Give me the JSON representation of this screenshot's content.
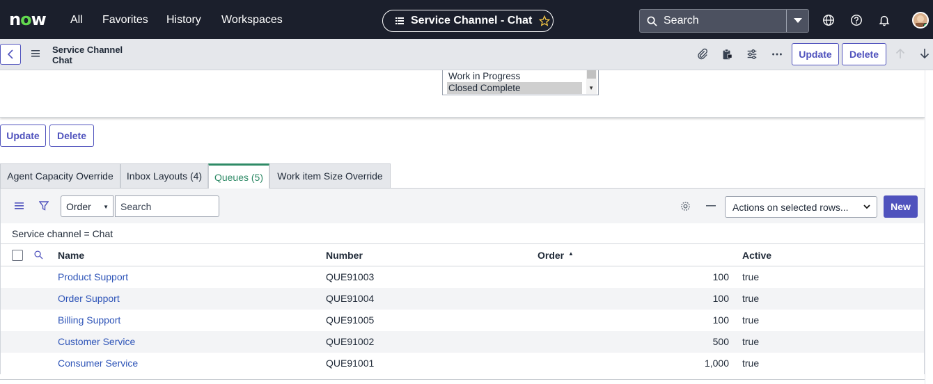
{
  "topnav": {
    "logo": "now",
    "links": [
      "All",
      "Favorites",
      "History",
      "Workspaces"
    ],
    "context_pill": "Service Channel - Chat",
    "search_label": "Search"
  },
  "formheader": {
    "title_line1": "Service Channel",
    "title_line2": "Chat",
    "update_label": "Update",
    "delete_label": "Delete"
  },
  "status_listbox": {
    "options": [
      "Work in Progress",
      "Closed Complete"
    ],
    "selected": "Closed Complete"
  },
  "form_buttons": {
    "update_label": "Update",
    "delete_label": "Delete"
  },
  "tabs": [
    {
      "label": "Agent Capacity Override",
      "active": false
    },
    {
      "label": "Inbox Layouts (4)",
      "active": false
    },
    {
      "label": "Queues (5)",
      "active": true
    },
    {
      "label": "Work item Size Override",
      "active": false
    }
  ],
  "listbar": {
    "search_field": "Order",
    "search_placeholder": "Search",
    "actions": "Actions on selected rows...",
    "new_label": "New"
  },
  "breadcrumb": "Service channel = Chat",
  "table": {
    "columns": [
      "Name",
      "Number",
      "Order",
      "Active"
    ],
    "rows": [
      {
        "name": "Product Support",
        "number": "QUE91003",
        "order": "100",
        "active": "true"
      },
      {
        "name": "Order Support",
        "number": "QUE91004",
        "order": "100",
        "active": "true"
      },
      {
        "name": "Billing Support",
        "number": "QUE91005",
        "order": "100",
        "active": "true"
      },
      {
        "name": "Customer Service",
        "number": "QUE91002",
        "order": "500",
        "active": "true"
      },
      {
        "name": "Consumer Service",
        "number": "QUE91001",
        "order": "1,000",
        "active": "true"
      }
    ]
  },
  "colors": {
    "nav_bg": "#1b1f2c",
    "accent": "#4f52bd",
    "active_tab": "#2e8a66",
    "link": "#2f55b8"
  }
}
